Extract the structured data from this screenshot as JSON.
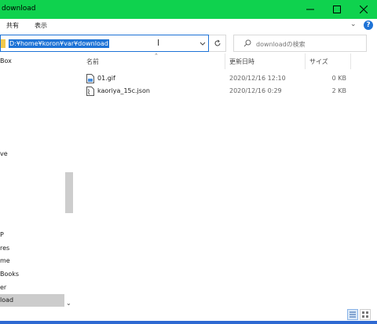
{
  "window": {
    "title": "download"
  },
  "ribbon": {
    "tabs": [
      "共有",
      "表示"
    ]
  },
  "address": {
    "path": "D:¥home¥koron¥var¥download"
  },
  "search": {
    "placeholder": "downloadの検索"
  },
  "nav": {
    "items": [
      "Box",
      "ve",
      "P",
      "res",
      "me",
      "Books",
      "er",
      "load"
    ],
    "selected_index": 7
  },
  "columns": {
    "name": "名前",
    "date": "更新日時",
    "size": "サイズ"
  },
  "files": [
    {
      "name": "01.gif",
      "date": "2020/12/16 12:10",
      "size": "0 KB",
      "icon": "gif-file-icon"
    },
    {
      "name": "kaoriya_15c.json",
      "date": "2020/12/16 0:29",
      "size": "2 KB",
      "icon": "json-file-icon"
    }
  ],
  "colors": {
    "titlebar": "#0fd24e",
    "accent": "#1e73d6",
    "selection": "#cccccc"
  }
}
